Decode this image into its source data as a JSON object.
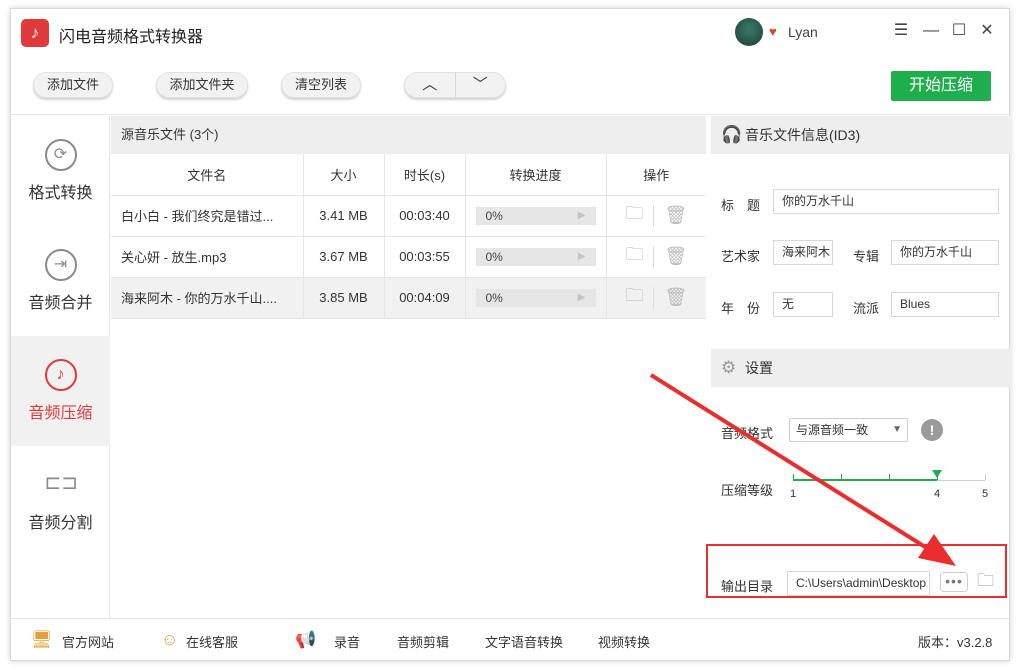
{
  "app": {
    "title": "闪电音频格式转换器",
    "logo_glyph": "♪"
  },
  "user": {
    "name": "Lyan"
  },
  "window_controls": {
    "menu": "☰",
    "minimize": "—",
    "maximize": "☐",
    "close": "✕"
  },
  "toolbar": {
    "add_file": "添加文件",
    "add_folder": "添加文件夹",
    "clear_list": "清空列表",
    "move_up": "︿",
    "move_down": "﹀",
    "start": "开始压缩"
  },
  "sidebar": {
    "items": [
      {
        "label": "格式转换",
        "icon": "refresh-icon",
        "glyph": "⟳"
      },
      {
        "label": "音频合并",
        "icon": "merge-icon",
        "glyph": "⇥"
      },
      {
        "label": "音频压缩",
        "icon": "music-note-icon",
        "glyph": "♪"
      },
      {
        "label": "音频分割",
        "icon": "split-icon",
        "glyph": "⊏⊐"
      }
    ],
    "active_index": 2
  },
  "filelist": {
    "header": "源音乐文件 (3个)",
    "columns": [
      "文件名",
      "大小",
      "时长(s)",
      "转换进度",
      "操作"
    ],
    "rows": [
      {
        "name": "白小白 - 我们终究是错过...",
        "size": "3.41 MB",
        "duration": "00:03:40",
        "progress": "0%"
      },
      {
        "name": "关心妍 - 放生.mp3",
        "size": "3.67 MB",
        "duration": "00:03:55",
        "progress": "0%"
      },
      {
        "name": "海来阿木 - 你的万水千山....",
        "size": "3.85 MB",
        "duration": "00:04:09",
        "progress": "0%"
      }
    ],
    "selected_index": 2
  },
  "info": {
    "header": "音乐文件信息(ID3)",
    "title_label": "标　题",
    "title_value": "你的万水千山",
    "artist_label": "艺术家",
    "artist_value": "海来阿木",
    "album_label": "专辑",
    "album_value": "你的万水千山",
    "year_label": "年　份",
    "year_value": "无",
    "genre_label": "流派",
    "genre_value": "Blues"
  },
  "settings": {
    "header": "设置",
    "format_label": "音频格式",
    "format_value": "与源音频一致",
    "warn_glyph": "!",
    "level_label": "压缩等级",
    "level_min": "1",
    "level_value": "4",
    "level_max": "5",
    "level_fraction": 0.75,
    "output_label": "输出目录",
    "output_value": "C:\\Users\\admin\\Desktop",
    "dots": "•••"
  },
  "bottombar": {
    "website": "官方网站",
    "support": "在线客服",
    "record": "录音",
    "edit": "音频剪辑",
    "tts": "文字语音转换",
    "video": "视频转换",
    "version": "版本：v3.2.8"
  },
  "colors": {
    "accent": "#e23a3a",
    "start_button": "#1fae4e",
    "annotation": "#ea2d2d"
  }
}
